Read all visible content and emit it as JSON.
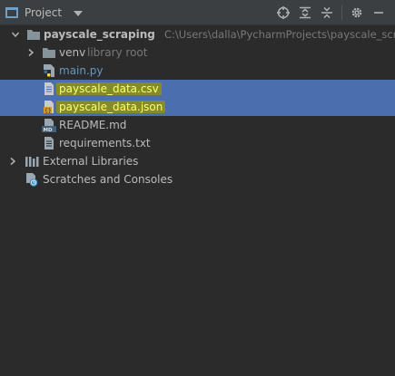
{
  "toolbar": {
    "title": "Project",
    "icons": [
      "project-icon",
      "chevron-down-icon",
      "locate-icon",
      "expand-all-icon",
      "collapse-all-icon",
      "gear-icon",
      "minimize-icon"
    ]
  },
  "tree": {
    "root": {
      "name": "payscale_scraping",
      "path": "C:\\Users\\dalla\\PycharmProjects\\payscale_scraping"
    },
    "venv": {
      "name": "venv",
      "note": "library root"
    },
    "files": {
      "main": "main.py",
      "csv": "payscale_data.csv",
      "json": "payscale_data.json",
      "readme": "README.md",
      "req": "requirements.txt"
    },
    "external": "External Libraries",
    "scratches": "Scratches and Consoles"
  },
  "colors": {
    "background": "#2b2b2b",
    "toolbar": "#3c3f41",
    "selection": "#4b6eaf",
    "highlight": "#969600",
    "highlight_text": "#ffff66",
    "file_link": "#6897bb"
  }
}
